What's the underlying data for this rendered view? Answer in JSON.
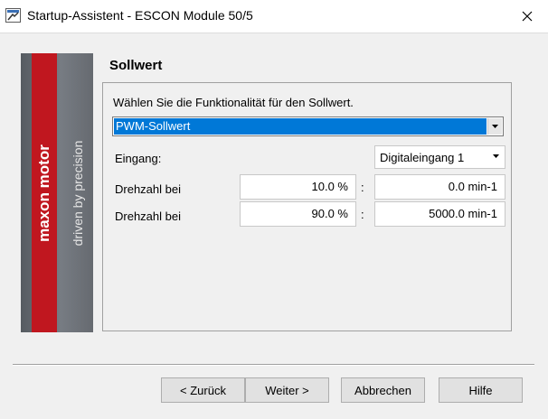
{
  "window": {
    "title": "Startup-Assistent - ESCON Module 50/5",
    "close_label": "×"
  },
  "banner": {
    "brand": "maxon motor",
    "tagline": "driven by precision"
  },
  "page": {
    "title": "Sollwert",
    "instruction": "Wählen Sie die Funktionalität für den Sollwert.",
    "functionality_select": "PWM-Sollwert",
    "input": {
      "label": "Eingang:",
      "value": "Digitaleingang 1"
    },
    "rows": [
      {
        "label": "Drehzahl bei",
        "percent": "10.0 %",
        "separator": ":",
        "speed": "0.0 min-1"
      },
      {
        "label": "Drehzahl bei",
        "percent": "90.0 %",
        "separator": ":",
        "speed": "5000.0 min-1"
      }
    ]
  },
  "buttons": {
    "back": "< Zurück",
    "next": "Weiter >",
    "cancel": "Abbrechen",
    "help": "Hilfe"
  },
  "colors": {
    "selection": "#0078d7",
    "brand_red": "#c0171f",
    "banner_gray": "#6b7076"
  }
}
